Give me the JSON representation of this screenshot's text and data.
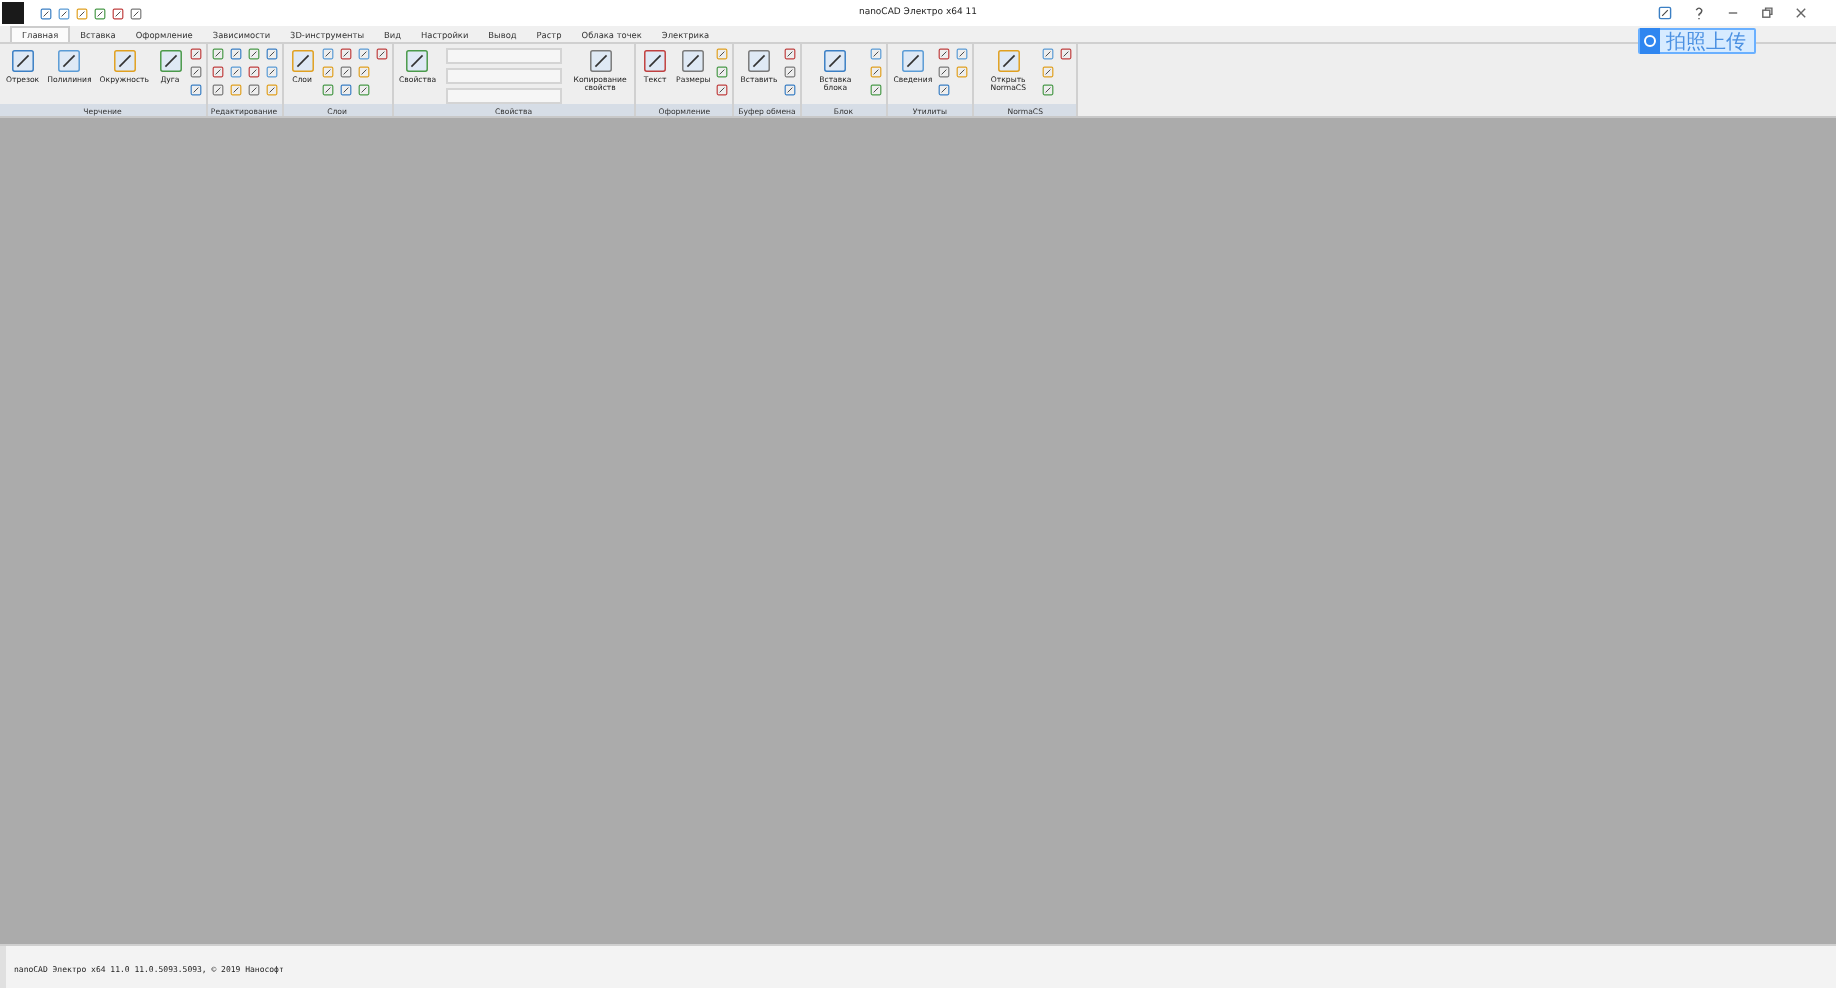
{
  "window": {
    "title": "nanoCAD Электро x64 11"
  },
  "tabs": [
    {
      "label": "Главная",
      "selected": true
    },
    {
      "label": "Вставка",
      "selected": false
    },
    {
      "label": "Оформление",
      "selected": false
    },
    {
      "label": "Зависимости",
      "selected": false
    },
    {
      "label": "3D-инструменты",
      "selected": false
    },
    {
      "label": "Вид",
      "selected": false
    },
    {
      "label": "Настройки",
      "selected": false
    },
    {
      "label": "Вывод",
      "selected": false
    },
    {
      "label": "Растр",
      "selected": false
    },
    {
      "label": "Облака точек",
      "selected": false
    },
    {
      "label": "Электрика",
      "selected": false
    }
  ],
  "upload_button": {
    "label": "拍照上传"
  },
  "panels": [
    {
      "title": "Черчение",
      "tools": [
        {
          "kind": "large",
          "label": "Отрезок"
        },
        {
          "kind": "large",
          "label": "Полилиния"
        },
        {
          "kind": "large",
          "label": "Окружность"
        },
        {
          "kind": "large",
          "label": "Дуга"
        },
        {
          "kind": "small"
        },
        {
          "kind": "small"
        },
        {
          "kind": "small"
        }
      ]
    },
    {
      "title": "Редактирование",
      "tools": [
        {
          "kind": "small"
        },
        {
          "kind": "small"
        },
        {
          "kind": "small"
        },
        {
          "kind": "small"
        },
        {
          "kind": "small"
        },
        {
          "kind": "small"
        },
        {
          "kind": "small"
        },
        {
          "kind": "small"
        },
        {
          "kind": "small"
        },
        {
          "kind": "small"
        },
        {
          "kind": "small"
        },
        {
          "kind": "small"
        }
      ]
    },
    {
      "title": "Слои",
      "tools": [
        {
          "kind": "large",
          "label": "Слои"
        },
        {
          "kind": "small"
        },
        {
          "kind": "small"
        },
        {
          "kind": "small"
        },
        {
          "kind": "small"
        },
        {
          "kind": "small"
        },
        {
          "kind": "small"
        },
        {
          "kind": "small"
        },
        {
          "kind": "small"
        },
        {
          "kind": "small"
        },
        {
          "kind": "small"
        }
      ]
    },
    {
      "title": "Свойства",
      "tools": [
        {
          "kind": "large",
          "label": "Свойства"
        },
        {
          "kind": "fields"
        },
        {
          "kind": "large",
          "label": "Копирование свойств"
        }
      ]
    },
    {
      "title": "Оформление",
      "tools": [
        {
          "kind": "large",
          "label": "Текст"
        },
        {
          "kind": "large",
          "label": "Размеры"
        },
        {
          "kind": "small"
        },
        {
          "kind": "small"
        },
        {
          "kind": "small"
        }
      ]
    },
    {
      "title": "Буфер обмена",
      "tools": [
        {
          "kind": "large",
          "label": "Вставить"
        },
        {
          "kind": "small"
        },
        {
          "kind": "small"
        },
        {
          "kind": "small"
        }
      ]
    },
    {
      "title": "Блок",
      "tools": [
        {
          "kind": "large",
          "label": "Вставка блока"
        },
        {
          "kind": "small"
        },
        {
          "kind": "small"
        },
        {
          "kind": "small"
        }
      ]
    },
    {
      "title": "Утилиты",
      "tools": [
        {
          "kind": "large",
          "label": "Сведения"
        },
        {
          "kind": "small"
        },
        {
          "kind": "small"
        },
        {
          "kind": "small"
        },
        {
          "kind": "small"
        },
        {
          "kind": "small"
        }
      ]
    },
    {
      "title": "NormaCS",
      "tools": [
        {
          "kind": "large",
          "label": "Открыть NormaCS"
        },
        {
          "kind": "small"
        },
        {
          "kind": "small"
        },
        {
          "kind": "small"
        },
        {
          "kind": "small"
        }
      ]
    }
  ],
  "command_line": {
    "text": "nanoCAD Электро x64 11.0 11.0.5093.5093, © 2019 Нанософт"
  }
}
